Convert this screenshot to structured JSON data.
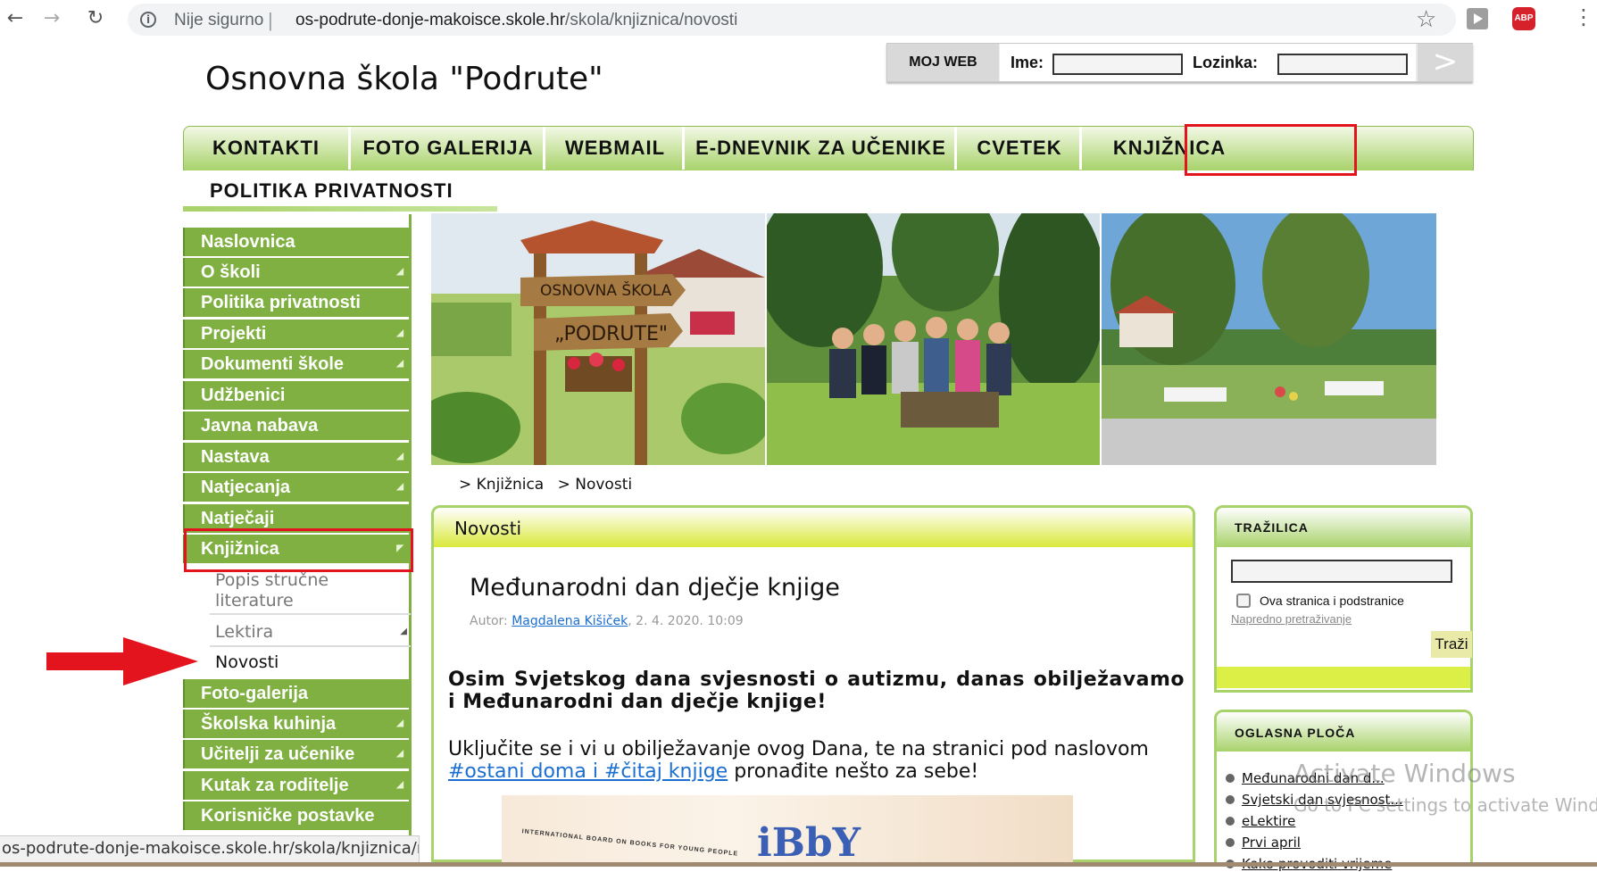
{
  "browser": {
    "not_secure": "Nije sigurno",
    "url_host": "os-podrute-donje-makoisce.skole.hr",
    "url_path": "/skola/knjiznica/novosti"
  },
  "site": {
    "title": "Osnovna škola \"Podrute\""
  },
  "login": {
    "moj_web": "MOJ WEB",
    "ime_label": "Ime:",
    "lozinka_label": "Lozinka:",
    "go": ">"
  },
  "topnav": {
    "items": [
      "KONTAKTI",
      "FOTO GALERIJA",
      "WEBMAIL",
      "E-DNEVNIK ZA UČENIKE",
      "CVETEK",
      "KNJIŽNICA"
    ],
    "second_row": "POLITIKA PRIVATNOSTI",
    "highlighted": "KNJIŽNICA"
  },
  "sidebar": {
    "items": [
      {
        "label": "Naslovnica"
      },
      {
        "label": "O školi"
      },
      {
        "label": "Politika privatnosti"
      },
      {
        "label": "Projekti"
      },
      {
        "label": "Dokumenti škole"
      },
      {
        "label": "Udžbenici"
      },
      {
        "label": "Javna nabava"
      },
      {
        "label": "Nastava"
      },
      {
        "label": "Natjecanja"
      },
      {
        "label": "Natječaji"
      },
      {
        "label": "Knjižnica"
      }
    ],
    "sub_items": [
      "Popis stručne literature",
      "Lektira",
      "Novosti"
    ],
    "items_after": [
      {
        "label": "Foto-galerija"
      },
      {
        "label": "Školska kuhinja"
      },
      {
        "label": "Učitelji za učenike"
      },
      {
        "label": "Kutak za roditelje"
      },
      {
        "label": "Korisničke postavke"
      }
    ]
  },
  "banner": {
    "sign_line1": "OSNOVNA ŠKOLA",
    "sign_line2": "„PODRUTE\""
  },
  "breadcrumb": [
    "> Knjižnica",
    "> Novosti"
  ],
  "content": {
    "section_title": "Novosti",
    "article_title": "Međunarodni dan dječje knjige",
    "meta_prefix": "Autor:",
    "author": "Magdalena Kišiček",
    "date": ", 2. 4. 2020. 10:09",
    "lead": "Osim Svjetskog dana svjesnosti o autizmu, danas obilježavamo i Međunarodni dan dječje knjige!",
    "p2_before": "Uključite se i vi u obilježavanje ovog Dana, te na stranici pod naslovom",
    "p2_link": "#ostani doma i #čitaj knjige",
    "p2_after": " pronađite nešto za sebe!",
    "ibby_small": "INTERNATIONAL BOARD ON BOOKS FOR YOUNG PEOPLE",
    "ibby_logo": "iBbY"
  },
  "search_box": {
    "title": "TRAŽILICA",
    "checkbox_label": "Ova stranica i podstranice",
    "advanced": "Napredno pretraživanje",
    "button": "Traži"
  },
  "announcements": {
    "title": "OGLASNA PLOČA",
    "items": [
      "Međunarodni dan d...",
      "Svjetski dan svjesnost...",
      "eLektire",
      "Prvi april",
      "Kako provoditi vrijeme"
    ]
  },
  "status_bar": "os-podrute-donje-makoisce.skole.hr/skola/knjiznica/novosti",
  "watermark": {
    "line1": "Activate Windows",
    "line2": "Go to PC settings to activate Windows."
  },
  "colors": {
    "sidebar_green": "#7fb041",
    "highlight_red": "#e3141d",
    "content_header_yellow": "#d9e93a",
    "link_blue": "#1a6fd0"
  }
}
